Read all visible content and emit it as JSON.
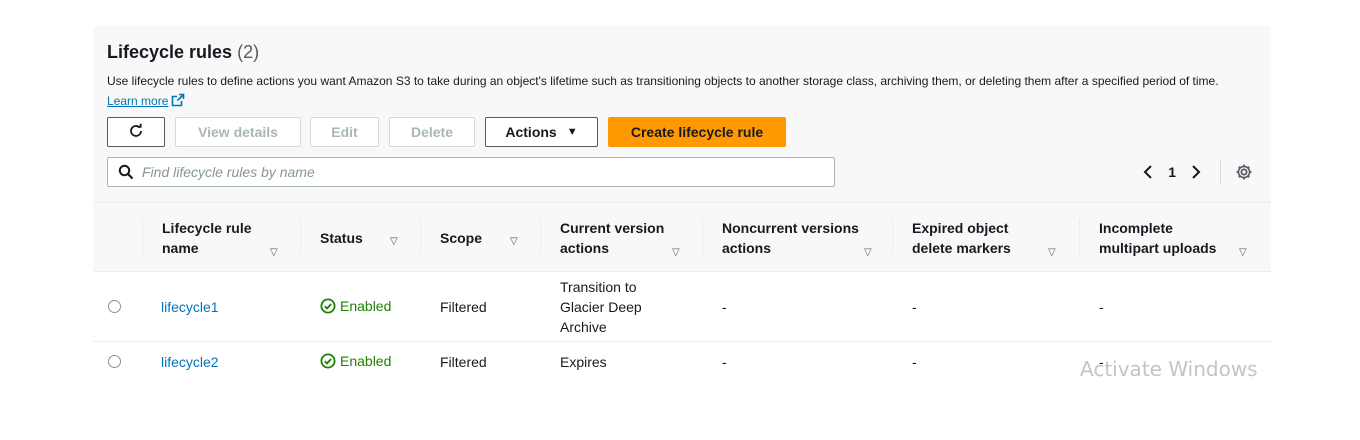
{
  "header": {
    "title": "Lifecycle rules",
    "count": "(2)",
    "description": "Use lifecycle rules to define actions you want Amazon S3 to take during an object's lifetime such as transitioning objects to another storage class, archiving them, or deleting them after a specified period of time.",
    "learn_more": "Learn more"
  },
  "toolbar": {
    "view_details": "View details",
    "edit": "Edit",
    "delete": "Delete",
    "actions": "Actions",
    "create": "Create lifecycle rule"
  },
  "search": {
    "placeholder": "Find lifecycle rules by name"
  },
  "pagination": {
    "page": "1"
  },
  "columns": [
    "Lifecycle rule name",
    "Status",
    "Scope",
    "Current version actions",
    "Noncurrent versions actions",
    "Expired object delete markers",
    "Incomplete multipart uploads"
  ],
  "rows": [
    {
      "name": "lifecycle1",
      "status": "Enabled",
      "scope": "Filtered",
      "current": "Transition to Glacier Deep Archive",
      "noncurrent": "-",
      "expired": "-",
      "incomplete": "-"
    },
    {
      "name": "lifecycle2",
      "status": "Enabled",
      "scope": "Filtered",
      "current": "Expires",
      "noncurrent": "-",
      "expired": "-",
      "incomplete": "-"
    }
  ],
  "watermark": "Activate Windows",
  "colors": {
    "accent": "#ff9900",
    "link": "#0073bb",
    "success": "#1d8102"
  }
}
